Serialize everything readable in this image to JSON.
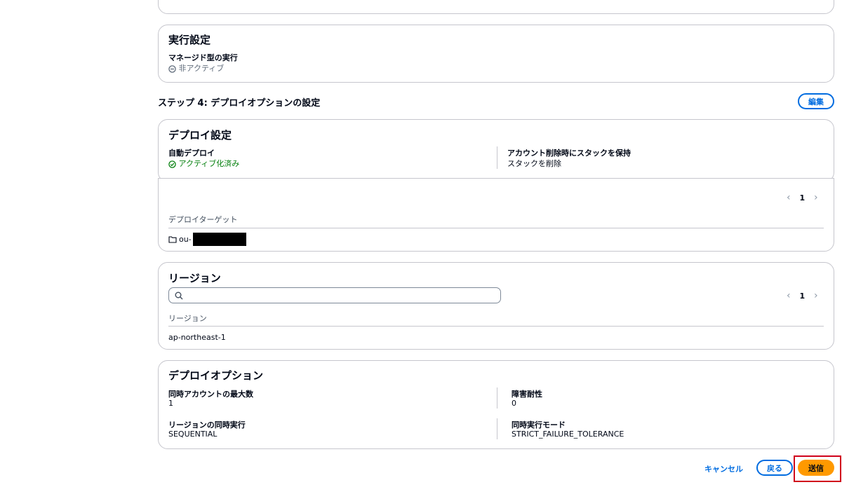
{
  "execution_settings": {
    "title": "実行設定",
    "managed_label": "マネージド型の実行",
    "managed_value": "非アクティブ"
  },
  "step4": {
    "title": "ステップ 4: デプロイオプションの設定",
    "edit_label": "編集"
  },
  "deploy_settings": {
    "title": "デプロイ設定",
    "auto_deploy_label": "自動デプロイ",
    "auto_deploy_value": "アクティブ化済み",
    "retain_label": "アカウント削除時にスタックを保持",
    "retain_value": "スタックを削除"
  },
  "deploy_targets": {
    "page": "1",
    "header": "デプロイターゲット",
    "ou_prefix": "ou-"
  },
  "regions": {
    "title": "リージョン",
    "search_placeholder": "",
    "page": "1",
    "header": "リージョン",
    "rows": [
      "ap-northeast-1"
    ]
  },
  "deploy_options": {
    "title": "デプロイオプション",
    "max_concurrent_label": "同時アカウントの最大数",
    "max_concurrent_value": "1",
    "failure_tolerance_label": "障害耐性",
    "failure_tolerance_value": "0",
    "region_concurrency_label": "リージョンの同時実行",
    "region_concurrency_value": "SEQUENTIAL",
    "concurrency_mode_label": "同時実行モード",
    "concurrency_mode_value": "STRICT_FAILURE_TOLERANCE"
  },
  "footer": {
    "cancel_label": "キャンセル",
    "back_label": "戻る",
    "submit_label": "送信"
  },
  "colors": {
    "primary_orange": "#ff9900",
    "link_blue": "#006ce0",
    "success_green": "#037f0c",
    "highlight_red": "#d0021b"
  }
}
